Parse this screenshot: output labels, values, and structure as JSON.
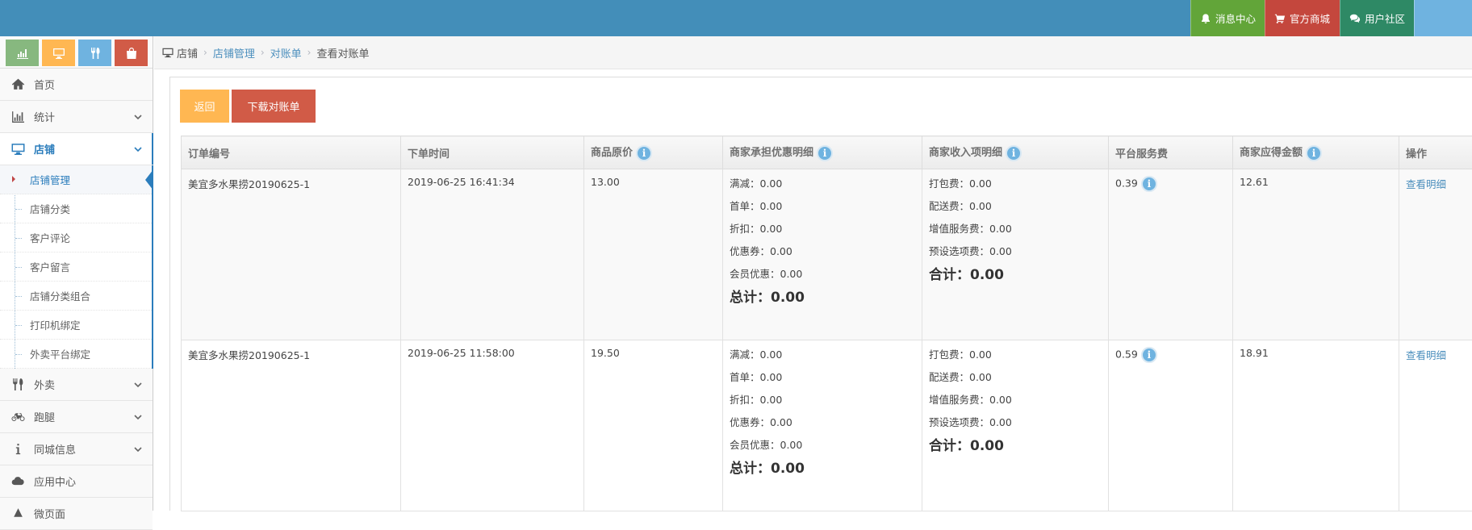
{
  "navbar": {
    "messages": "消息中心",
    "store": "官方商城",
    "community": "用户社区"
  },
  "sidebar": {
    "shortcuts": [
      "signal-icon",
      "desktop-icon",
      "utensils-icon",
      "bag-icon"
    ],
    "items": {
      "home": "首页",
      "stats": "统计",
      "shop": "店铺",
      "takeout": "外卖",
      "errand": "跑腿",
      "citywide": "同城信息",
      "apps": "应用中心",
      "micro": "微页面"
    },
    "shop_sub": [
      "店铺管理",
      "店铺分类",
      "客户评论",
      "客户留言",
      "店铺分类组合",
      "打印机绑定",
      "外卖平台绑定"
    ]
  },
  "breadcrumb": {
    "home": "店铺",
    "level1": "店铺管理",
    "level2": "对账单",
    "current": "查看对账单"
  },
  "actions": {
    "back": "返回",
    "download": "下载对账单"
  },
  "table": {
    "headers": [
      "订单编号",
      "下单时间",
      "商品原价",
      "商家承担优惠明细",
      "商家收入项明细",
      "平台服务费",
      "商家应得金额",
      "操作"
    ],
    "rows": [
      {
        "order_no": "美宜多水果捞20190625-1",
        "time": "2019-06-25 16:41:34",
        "price": "13.00",
        "discounts": [
          "满减：0.00",
          "首单：0.00",
          "折扣：0.00",
          "优惠券：0.00",
          "会员优惠：0.00"
        ],
        "discount_total": "总计：0.00",
        "income": [
          "打包费：0.00",
          "配送费：0.00",
          "增值服务费：0.00",
          "预设选项费：0.00"
        ],
        "income_total": "合计：0.00",
        "service_fee": "0.39",
        "amount": "12.61",
        "action": "查看明细"
      },
      {
        "order_no": "美宜多水果捞20190625-1",
        "time": "2019-06-25 11:58:00",
        "price": "19.50",
        "discounts": [
          "满减：0.00",
          "首单：0.00",
          "折扣：0.00",
          "优惠券：0.00",
          "会员优惠：0.00"
        ],
        "discount_total": "总计：0.00",
        "income": [
          "打包费：0.00",
          "配送费：0.00",
          "增值服务费：0.00",
          "预设选项费：0.00"
        ],
        "income_total": "合计：0.00",
        "service_fee": "0.59",
        "amount": "18.91",
        "action": "查看明细"
      }
    ]
  },
  "colors": {
    "navbar": "#438eb9",
    "accent": "#2b7dbc",
    "btn_back": "#ffb752",
    "btn_download": "#d15b47"
  }
}
